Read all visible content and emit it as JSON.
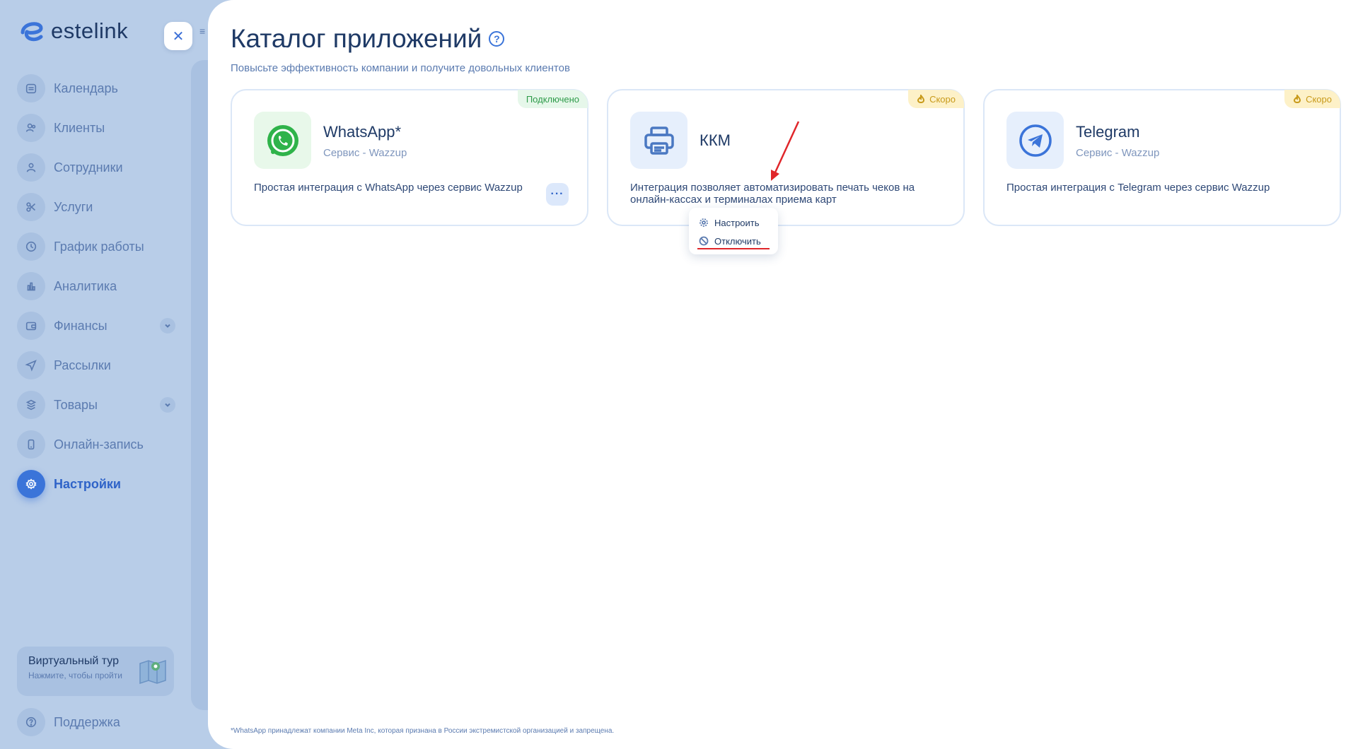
{
  "brand": {
    "name": "estelink"
  },
  "sidebar": {
    "items": [
      {
        "label": "Календарь",
        "icon": "calendar-icon"
      },
      {
        "label": "Клиенты",
        "icon": "clients-icon"
      },
      {
        "label": "Сотрудники",
        "icon": "user-icon"
      },
      {
        "label": "Услуги",
        "icon": "scissors-icon"
      },
      {
        "label": "График работы",
        "icon": "clock-icon"
      },
      {
        "label": "Аналитика",
        "icon": "chart-icon"
      },
      {
        "label": "Финансы",
        "icon": "wallet-icon"
      },
      {
        "label": "Рассылки",
        "icon": "send-icon"
      },
      {
        "label": "Товары",
        "icon": "box-icon"
      },
      {
        "label": "Онлайн-запись",
        "icon": "phone-icon"
      },
      {
        "label": "Настройки",
        "icon": "gear-icon"
      }
    ],
    "tour": {
      "title": "Виртуальный тур",
      "subtitle": "Нажмите, чтобы пройти"
    },
    "support": {
      "label": "Поддержка"
    }
  },
  "main": {
    "title": "Каталог приложений",
    "subtitle": "Повысьте эффективность компании и получите довольных клиентов",
    "cards": [
      {
        "name": "WhatsApp*",
        "service": "Сервис - Wazzup",
        "description": "Простая интеграция с WhatsApp через сервис Wazzup",
        "badge": "Подключено",
        "badge_color": "#2e9b4a",
        "more_label": "···"
      },
      {
        "name": "ККМ",
        "description": "Интеграция позволяет автоматизировать печать чеков на онлайн-кассах и терминалах приема карт",
        "badge": "Скоро",
        "badge_color": "#c89a1a"
      },
      {
        "name": "Telegram",
        "service": "Сервис - Wazzup",
        "description": "Простая интеграция с Telegram через сервис Wazzup",
        "badge": "Скоро",
        "badge_color": "#c89a1a"
      }
    ],
    "dropdown": {
      "configure": "Настроить",
      "disconnect": "Отключить"
    },
    "footnote": "*WhatsApp принадлежат компании Meta Inc, которая признана в России экстремистской организацией и запрещена."
  },
  "colors": {
    "accent": "#3b74d9",
    "sidebar_bg": "#b8cde8",
    "title": "#1f3a66",
    "annotation": "#e0262a"
  }
}
